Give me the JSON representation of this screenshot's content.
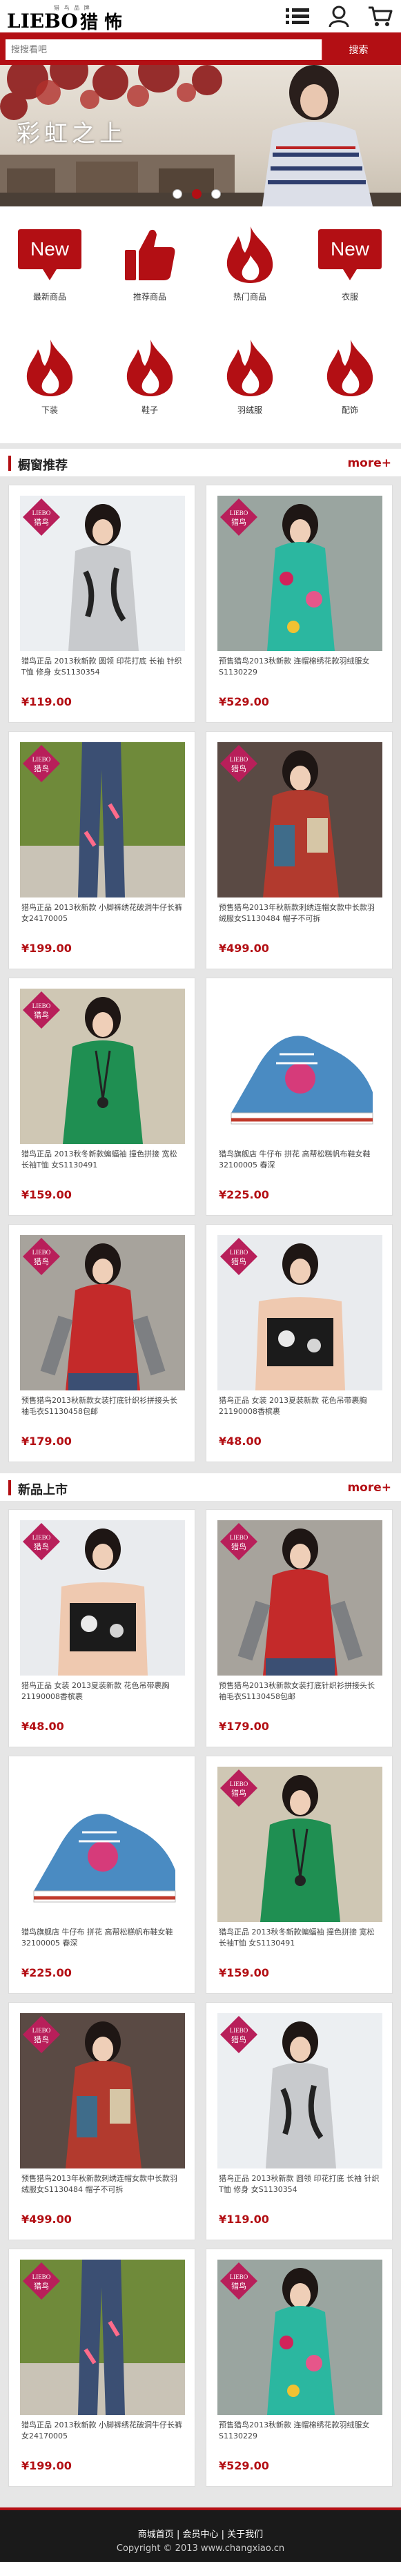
{
  "header": {
    "logo_latin": "LIEBO",
    "logo_cn": "猎 怖",
    "logo_small": "猎 鸟 品 牌",
    "icons": [
      "menu-icon",
      "user-icon",
      "cart-icon"
    ]
  },
  "search": {
    "placeholder": "搜搜看吧",
    "button_label": "搜索"
  },
  "banner": {
    "text": "彩虹之上",
    "slides": 3,
    "active_index": 1
  },
  "categories": [
    {
      "label": "最新商品",
      "icon": "new-badge-icon"
    },
    {
      "label": "推荐商品",
      "icon": "thumbs-up-icon"
    },
    {
      "label": "热门商品",
      "icon": "flame-icon"
    },
    {
      "label": "衣服",
      "icon": "new-badge-icon"
    },
    {
      "label": "下装",
      "icon": "flame-icon"
    },
    {
      "label": "鞋子",
      "icon": "flame-icon"
    },
    {
      "label": "羽绒服",
      "icon": "flame-icon"
    },
    {
      "label": "配饰",
      "icon": "flame-icon"
    }
  ],
  "colors": {
    "accent": "#b30f14",
    "price": "#b30f14"
  },
  "sections": [
    {
      "title": "橱窗推荐",
      "more": "more+",
      "products": [
        {
          "name": "猎鸟正品 2013秋新款 圆领 印花打底 长袖 针织T恤 修身 女S1130354",
          "price": "¥119.00",
          "img": "grey-top"
        },
        {
          "name": "预售猎鸟2013秋新款 连帽棉绣花款羽绒服女S1130229",
          "price": "¥529.00",
          "img": "floral-down"
        },
        {
          "name": "猎鸟正品 2013秋新款 小脚裤绣花破洞牛仔长裤女24170005",
          "price": "¥199.00",
          "img": "jeans"
        },
        {
          "name": "预售猎鸟2013年秋新款刺绣连帽女款中长款羽绒服女S1130484 帽子不可拆",
          "price": "¥499.00",
          "img": "patch-coat"
        },
        {
          "name": "猎鸟正品 2013秋冬新款蝙蝠袖 撞色拼接 宽松长袖T恤 女S1130491",
          "price": "¥159.00",
          "img": "green-top"
        },
        {
          "name": "猎鸟旗舰店 牛仔布 拼花 高帮松糕帆布鞋女鞋32100005 春深",
          "price": "¥225.00",
          "img": "sneaker"
        },
        {
          "name": "预售猎鸟2013秋新款女装打底针织衫拼接头长袖毛衣S1130458包邮",
          "price": "¥179.00",
          "img": "red-sweater"
        },
        {
          "name": "猎鸟正品 女装 2013夏装新款 花色吊带裹胸 21190008香槟裹",
          "price": "¥48.00",
          "img": "tube-top"
        }
      ]
    },
    {
      "title": "新品上市",
      "more": "more+",
      "products": [
        {
          "name": "猎鸟正品 女装 2013夏装新款 花色吊带裹胸 21190008香槟裹",
          "price": "¥48.00",
          "img": "tube-top"
        },
        {
          "name": "预售猎鸟2013秋新款女装打底针织衫拼接头长袖毛衣S1130458包邮",
          "price": "¥179.00",
          "img": "red-sweater"
        },
        {
          "name": "猎鸟旗舰店 牛仔布 拼花 高帮松糕帆布鞋女鞋32100005 春深",
          "price": "¥225.00",
          "img": "sneaker"
        },
        {
          "name": "猎鸟正品 2013秋冬新款蝙蝠袖 撞色拼接 宽松长袖T恤 女S1130491",
          "price": "¥159.00",
          "img": "green-top"
        },
        {
          "name": "预售猎鸟2013年秋新款刺绣连帽女款中长款羽绒服女S1130484 帽子不可拆",
          "price": "¥499.00",
          "img": "patch-coat"
        },
        {
          "name": "猎鸟正品 2013秋新款 圆领 印花打底 长袖 针织T恤 修身 女S1130354",
          "price": "¥119.00",
          "img": "grey-top"
        },
        {
          "name": "猎鸟正品 2013秋新款 小脚裤绣花破洞牛仔长裤女24170005",
          "price": "¥199.00",
          "img": "jeans"
        },
        {
          "name": "预售猎鸟2013秋新款 连帽棉绣花款羽绒服女S1130229",
          "price": "¥529.00",
          "img": "floral-down"
        }
      ]
    }
  ],
  "badge": {
    "latin": "LIEBO",
    "cn": "猎鸟"
  },
  "footer": {
    "links": [
      "商城首页",
      "会员中心",
      "关于我们"
    ],
    "separator": "|",
    "copyright": "Copyright © 2013 www.changxiao.cn"
  }
}
